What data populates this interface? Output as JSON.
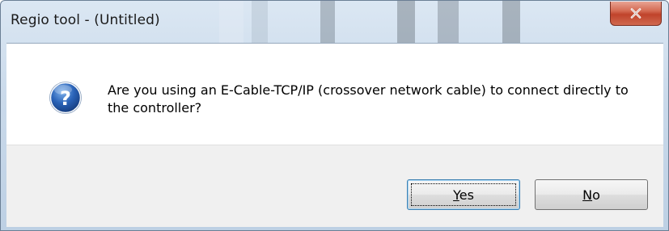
{
  "window": {
    "title": "Regio tool - (Untitled)"
  },
  "dialog": {
    "icon": "question-icon",
    "message": "Are you using an E-Cable-TCP/IP (crossover network cable) to connect directly to the controller?"
  },
  "buttons": {
    "yes_mnemonic": "Y",
    "yes_rest": "es",
    "no_mnemonic": "N",
    "no_rest": "o"
  },
  "colors": {
    "titlebar": "#c9d9ea",
    "close_button": "#c0432b",
    "question_icon": "#2a63b8",
    "footer": "#f0f0f0"
  }
}
